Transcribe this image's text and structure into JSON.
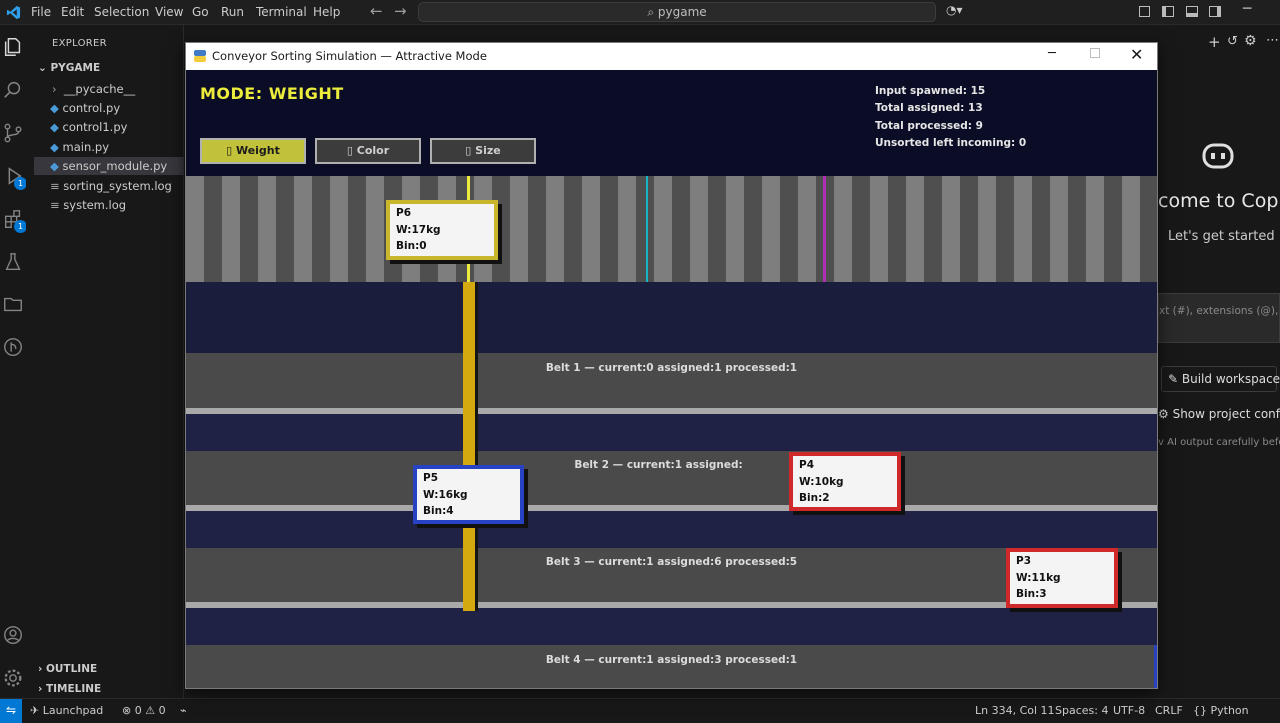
{
  "menu": [
    "File",
    "Edit",
    "Selection",
    "View",
    "Go",
    "Run",
    "Terminal",
    "Help"
  ],
  "search": {
    "text": "pygame"
  },
  "explorer": {
    "title": "EXPLORER",
    "folder": "PYGAME",
    "items": [
      "__pycache__",
      "control.py",
      "control1.py",
      "main.py",
      "sensor_module.py",
      "sorting_system.log",
      "system.log"
    ],
    "outline": "OUTLINE",
    "timeline": "TIMELINE"
  },
  "activity_badges": {
    "run": "1",
    "extensions": "1"
  },
  "chat": {
    "welcome": "come to Cop",
    "subtitle": "Let's get started",
    "input_hint": "xt (#), extensions (@), co",
    "build": "Build workspace",
    "config": "Show project config",
    "note": "v AI output carefully befor"
  },
  "status": {
    "launchpad": "Launchpad",
    "problems": "0",
    "warnings": "0",
    "position": "Ln 334, Col 11",
    "spaces": "Spaces: 4",
    "encoding": "UTF-8",
    "eol": "CRLF",
    "language": "Python"
  },
  "window": {
    "title": "Conveyor Sorting Simulation — Attractive Mode"
  },
  "game": {
    "mode": "MODE: WEIGHT",
    "buttons": [
      "▯ Weight",
      "▯ Color",
      "▯ Size"
    ],
    "active_button": 0,
    "stats": [
      "Input spawned: 15",
      "Total assigned: 13",
      "Total processed: 9",
      "Unsorted left incoming: 0"
    ],
    "belts": [
      "Belt 1 — current:0 assigned:1 processed:1",
      "Belt 2 — current:1 assigned:",
      "Belt 3 — current:1 assigned:6 processed:5",
      "Belt 4 — current:1 assigned:3 processed:1"
    ],
    "packages": [
      {
        "id": "P6",
        "weight": "W:17kg",
        "bin": "Bin:0",
        "color": "#c9b62b"
      },
      {
        "id": "P5",
        "weight": "W:16kg",
        "bin": "Bin:4",
        "color": "#2743c4"
      },
      {
        "id": "P4",
        "weight": "W:10kg",
        "bin": "Bin:2",
        "color": "#cf2929"
      },
      {
        "id": "P3",
        "weight": "W:11kg",
        "bin": "Bin:3",
        "color": "#cf2929"
      }
    ],
    "colors": {
      "background": "#0b0d26",
      "accent": "#ecec3c",
      "diverter": "#d4a910",
      "sensor_cyan": "#17b6c4",
      "sensor_magenta": "#b02fb4"
    }
  }
}
